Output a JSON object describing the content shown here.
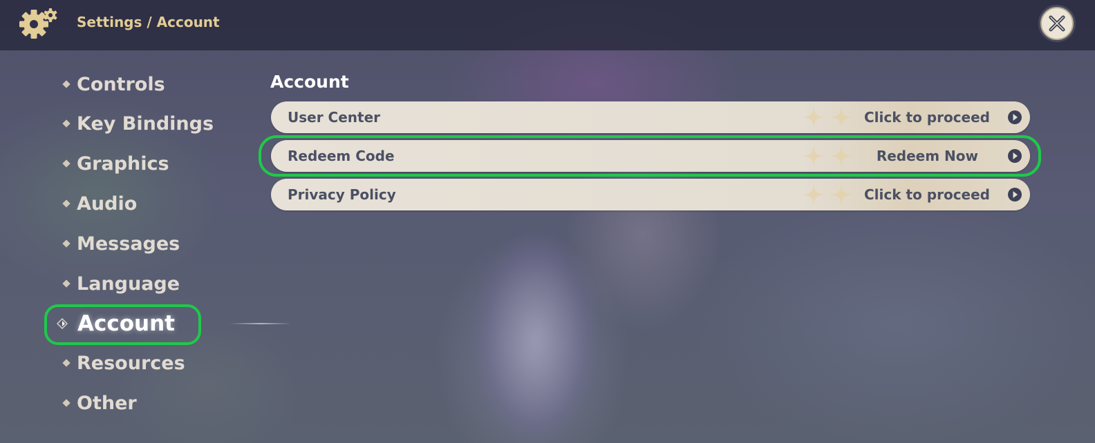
{
  "header": {
    "breadcrumb": "Settings / Account",
    "icon": "gear-icon",
    "close_icon": "close-icon"
  },
  "sidebar": {
    "items": [
      {
        "label": "Controls",
        "active": false
      },
      {
        "label": "Key Bindings",
        "active": false
      },
      {
        "label": "Graphics",
        "active": false
      },
      {
        "label": "Audio",
        "active": false
      },
      {
        "label": "Messages",
        "active": false
      },
      {
        "label": "Language",
        "active": false
      },
      {
        "label": "Account",
        "active": true
      },
      {
        "label": "Resources",
        "active": false
      },
      {
        "label": "Other",
        "active": false
      }
    ]
  },
  "main": {
    "title": "Account",
    "rows": [
      {
        "label": "User Center",
        "action": "Click to proceed",
        "highlighted": false
      },
      {
        "label": "Redeem Code",
        "action": "Redeem Now",
        "highlighted": true
      },
      {
        "label": "Privacy Policy",
        "action": "Click to proceed",
        "highlighted": false
      }
    ]
  },
  "colors": {
    "accent_gold": "#e3cd96",
    "highlight_green": "#1fc94a",
    "row_text": "#4b5063"
  }
}
